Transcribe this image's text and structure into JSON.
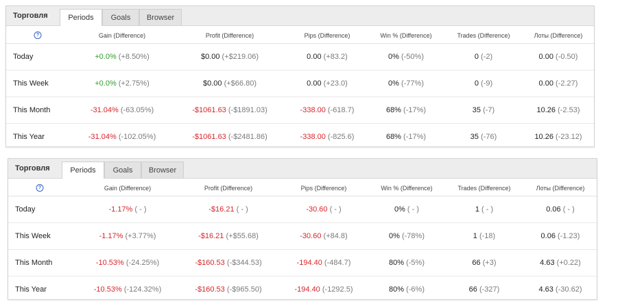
{
  "panels": [
    {
      "title": "Торговля",
      "tabs": [
        "Periods",
        "Goals",
        "Browser"
      ],
      "active_tab": "Periods",
      "columns": [
        "Gain (Difference)",
        "Profit (Difference)",
        "Pips (Difference)",
        "Win % (Difference)",
        "Trades (Difference)",
        "Лоты (Difference)"
      ],
      "help_icon": "?",
      "rows": [
        {
          "label": "Today",
          "cells": [
            {
              "value": "+0.0%",
              "diff": "(+8.50%)",
              "tone": "pos"
            },
            {
              "value": "$0.00",
              "diff": "(+$219.06)",
              "tone": "neutral"
            },
            {
              "value": "0.00",
              "diff": "(+83.2)",
              "tone": "neutral"
            },
            {
              "value": "0%",
              "diff": "(-50%)",
              "tone": "neutral"
            },
            {
              "value": "0",
              "diff": "(-2)",
              "tone": "neutral"
            },
            {
              "value": "0.00",
              "diff": "(-0.50)",
              "tone": "neutral"
            }
          ]
        },
        {
          "label": "This Week",
          "cells": [
            {
              "value": "+0.0%",
              "diff": "(+2.75%)",
              "tone": "pos"
            },
            {
              "value": "$0.00",
              "diff": "(+$66.80)",
              "tone": "neutral"
            },
            {
              "value": "0.00",
              "diff": "(+23.0)",
              "tone": "neutral"
            },
            {
              "value": "0%",
              "diff": "(-77%)",
              "tone": "neutral"
            },
            {
              "value": "0",
              "diff": "(-9)",
              "tone": "neutral"
            },
            {
              "value": "0.00",
              "diff": "(-2.27)",
              "tone": "neutral"
            }
          ]
        },
        {
          "label": "This Month",
          "cells": [
            {
              "value": "-31.04%",
              "diff": "(-63.05%)",
              "tone": "neg"
            },
            {
              "value": "-$1061.63",
              "diff": "(-$1891.03)",
              "tone": "neg"
            },
            {
              "value": "-338.00",
              "diff": "(-618.7)",
              "tone": "neg"
            },
            {
              "value": "68%",
              "diff": "(-17%)",
              "tone": "neutral"
            },
            {
              "value": "35",
              "diff": "(-7)",
              "tone": "neutral"
            },
            {
              "value": "10.26",
              "diff": "(-2.53)",
              "tone": "neutral"
            }
          ]
        },
        {
          "label": "This Year",
          "cells": [
            {
              "value": "-31.04%",
              "diff": "(-102.05%)",
              "tone": "neg"
            },
            {
              "value": "-$1061.63",
              "diff": "(-$2481.86)",
              "tone": "neg"
            },
            {
              "value": "-338.00",
              "diff": "(-825.6)",
              "tone": "neg"
            },
            {
              "value": "68%",
              "diff": "(-17%)",
              "tone": "neutral"
            },
            {
              "value": "35",
              "diff": "(-76)",
              "tone": "neutral"
            },
            {
              "value": "10.26",
              "diff": "(-23.12)",
              "tone": "neutral"
            }
          ]
        }
      ]
    },
    {
      "title": "Торговля",
      "tabs": [
        "Periods",
        "Goals",
        "Browser"
      ],
      "active_tab": "Periods",
      "columns": [
        "Gain (Difference)",
        "Profit (Difference)",
        "Pips (Difference)",
        "Win % (Difference)",
        "Trades (Difference)",
        "Лоты (Difference)"
      ],
      "help_icon": "?",
      "rows": [
        {
          "label": "Today",
          "cells": [
            {
              "value": "-1.17%",
              "diff": "( - )",
              "tone": "neg"
            },
            {
              "value": "-$16.21",
              "diff": "( - )",
              "tone": "neg"
            },
            {
              "value": "-30.60",
              "diff": "( - )",
              "tone": "neg"
            },
            {
              "value": "0%",
              "diff": "( - )",
              "tone": "neutral"
            },
            {
              "value": "1",
              "diff": "( - )",
              "tone": "neutral"
            },
            {
              "value": "0.06",
              "diff": "( - )",
              "tone": "neutral"
            }
          ]
        },
        {
          "label": "This Week",
          "cells": [
            {
              "value": "-1.17%",
              "diff": "(+3.77%)",
              "tone": "neg"
            },
            {
              "value": "-$16.21",
              "diff": "(+$55.68)",
              "tone": "neg"
            },
            {
              "value": "-30.60",
              "diff": "(+84.8)",
              "tone": "neg"
            },
            {
              "value": "0%",
              "diff": "(-78%)",
              "tone": "neutral"
            },
            {
              "value": "1",
              "diff": "(-18)",
              "tone": "neutral"
            },
            {
              "value": "0.06",
              "diff": "(-1.23)",
              "tone": "neutral"
            }
          ]
        },
        {
          "label": "This Month",
          "cells": [
            {
              "value": "-10.53%",
              "diff": "(-24.25%)",
              "tone": "neg"
            },
            {
              "value": "-$160.53",
              "diff": "(-$344.53)",
              "tone": "neg"
            },
            {
              "value": "-194.40",
              "diff": "(-484.7)",
              "tone": "neg"
            },
            {
              "value": "80%",
              "diff": "(-5%)",
              "tone": "neutral"
            },
            {
              "value": "66",
              "diff": "(+3)",
              "tone": "neutral"
            },
            {
              "value": "4.63",
              "diff": "(+0.22)",
              "tone": "neutral"
            }
          ]
        },
        {
          "label": "This Year",
          "cells": [
            {
              "value": "-10.53%",
              "diff": "(-124.32%)",
              "tone": "neg"
            },
            {
              "value": "-$160.53",
              "diff": "(-$965.50)",
              "tone": "neg"
            },
            {
              "value": "-194.40",
              "diff": "(-1292.5)",
              "tone": "neg"
            },
            {
              "value": "80%",
              "diff": "(-6%)",
              "tone": "neutral"
            },
            {
              "value": "66",
              "diff": "(-327)",
              "tone": "neutral"
            },
            {
              "value": "4.63",
              "diff": "(-30.62)",
              "tone": "neutral"
            }
          ]
        }
      ]
    }
  ],
  "colors": {
    "positive": "#2f9a2f",
    "negative": "#d6262b",
    "difference": "#7a7a7a",
    "help_icon": "#3a64c8"
  }
}
